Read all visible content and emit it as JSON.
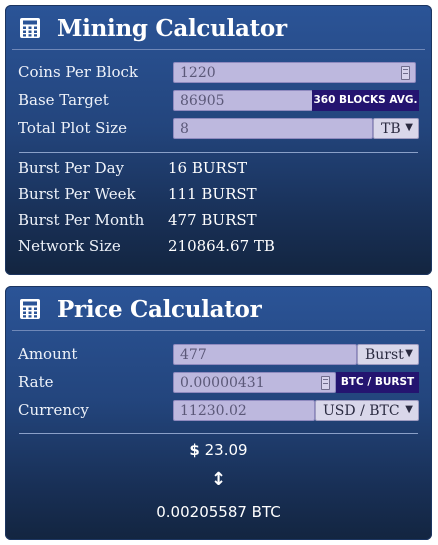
{
  "mining": {
    "title": "Mining Calculator",
    "coins_per_block": {
      "label": "Coins Per Block",
      "value": "1220"
    },
    "base_target": {
      "label": "Base Target",
      "value": "86905",
      "badge": "360 BLOCKS AVG."
    },
    "plot_size": {
      "label": "Total Plot Size",
      "value": "8",
      "unit": "TB"
    },
    "results": [
      {
        "label": "Burst Per Day",
        "value": "16 BURST"
      },
      {
        "label": "Burst Per Week",
        "value": "111 BURST"
      },
      {
        "label": "Burst Per Month",
        "value": "477 BURST"
      },
      {
        "label": "Network Size",
        "value": "210864.67 TB"
      }
    ]
  },
  "price": {
    "title": "Price Calculator",
    "amount": {
      "label": "Amount",
      "value": "477",
      "unit": "Burst"
    },
    "rate": {
      "label": "Rate",
      "value": "0.00000431",
      "badge": "BTC / BURST"
    },
    "currency": {
      "label": "Currency",
      "value": "11230.02",
      "unit": "USD / BTC"
    },
    "result_fiat_symbol": "$",
    "result_fiat": "23.09",
    "arrow": "↕",
    "result_btc": "0.00205587 BTC"
  },
  "icons": {
    "header_icon": "calculator-icon"
  },
  "colors": {
    "panel": "#2b5497",
    "badge": "#241470",
    "input": "#bdb8de"
  }
}
